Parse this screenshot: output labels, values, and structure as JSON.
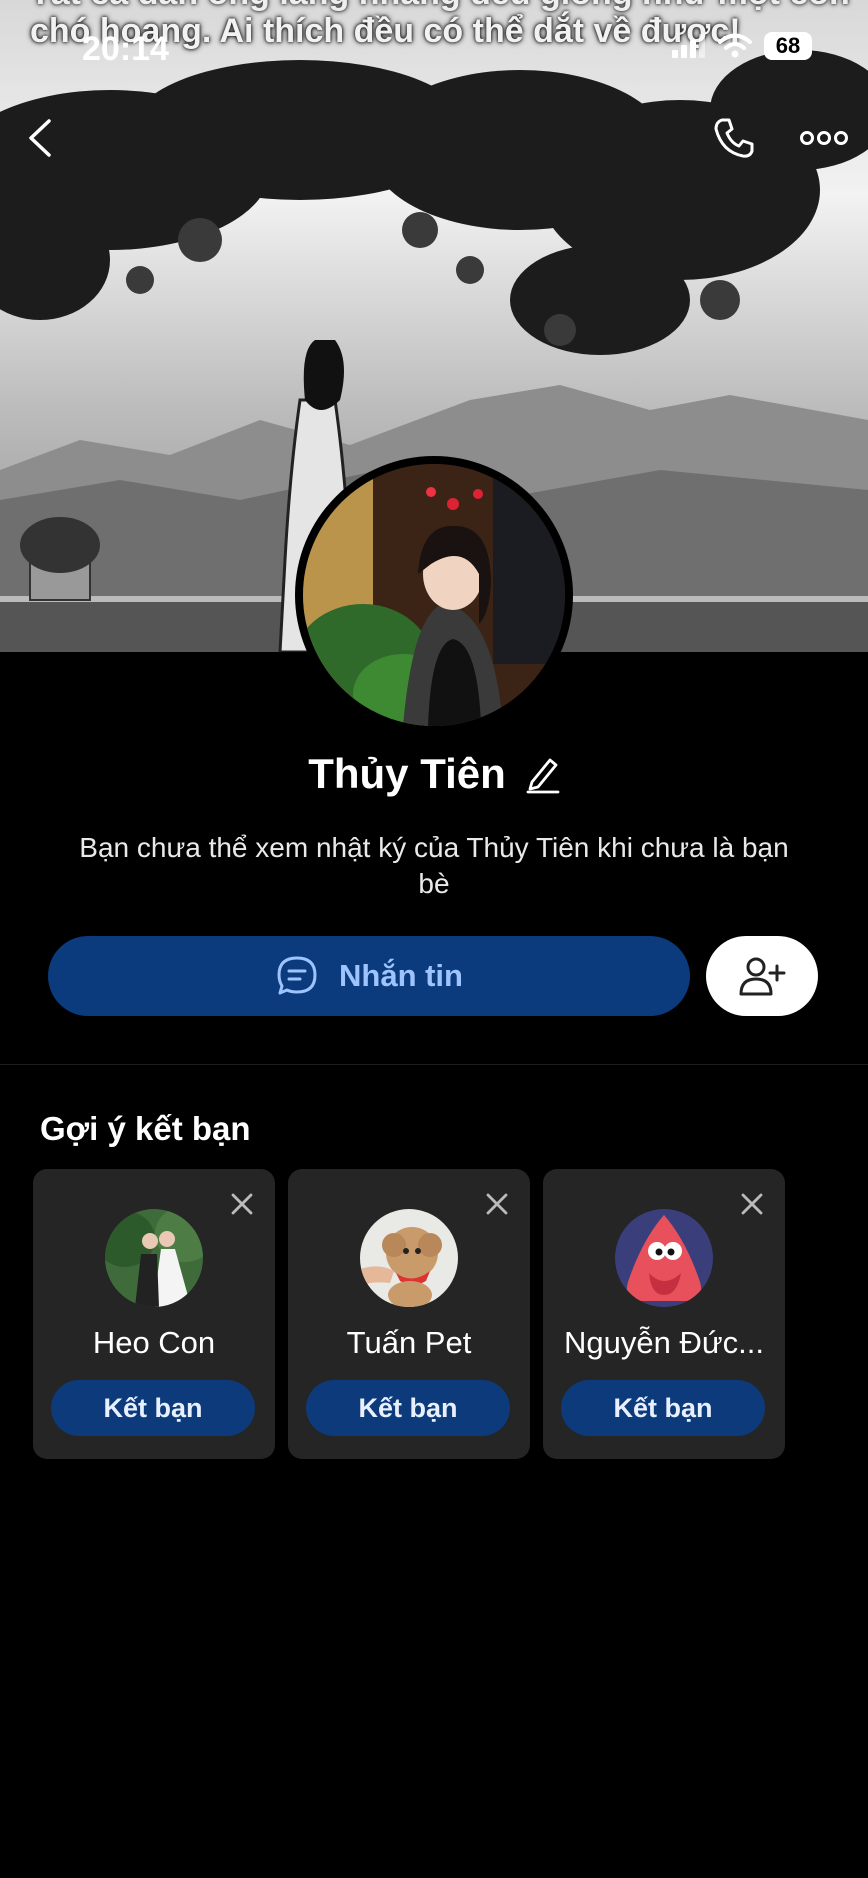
{
  "status_bar": {
    "time": "20:14",
    "battery": "68"
  },
  "cover": {
    "caption_line1": "Tất cả đàn ông lang nhang đều giống như một con",
    "caption_line2": "chó hoang. Ai thích đều có thể dắt về được!"
  },
  "profile": {
    "name": "Thủy Tiên",
    "note": "Bạn chưa thể xem nhật ký của Thủy Tiên khi chưa là bạn bè"
  },
  "actions": {
    "message_label": "Nhắn tin"
  },
  "suggestions": {
    "title": "Gợi ý kết bạn",
    "items": [
      {
        "name": "Heo Con",
        "button": "Kết bạn"
      },
      {
        "name": "Tuấn Pet",
        "button": "Kết bạn"
      },
      {
        "name": "Nguyễn Đức...",
        "button": "Kết bạn"
      }
    ]
  },
  "colors": {
    "accent_button": "#0b3b7d",
    "accent_text": "#9ec4ff",
    "card_bg": "#252525"
  }
}
